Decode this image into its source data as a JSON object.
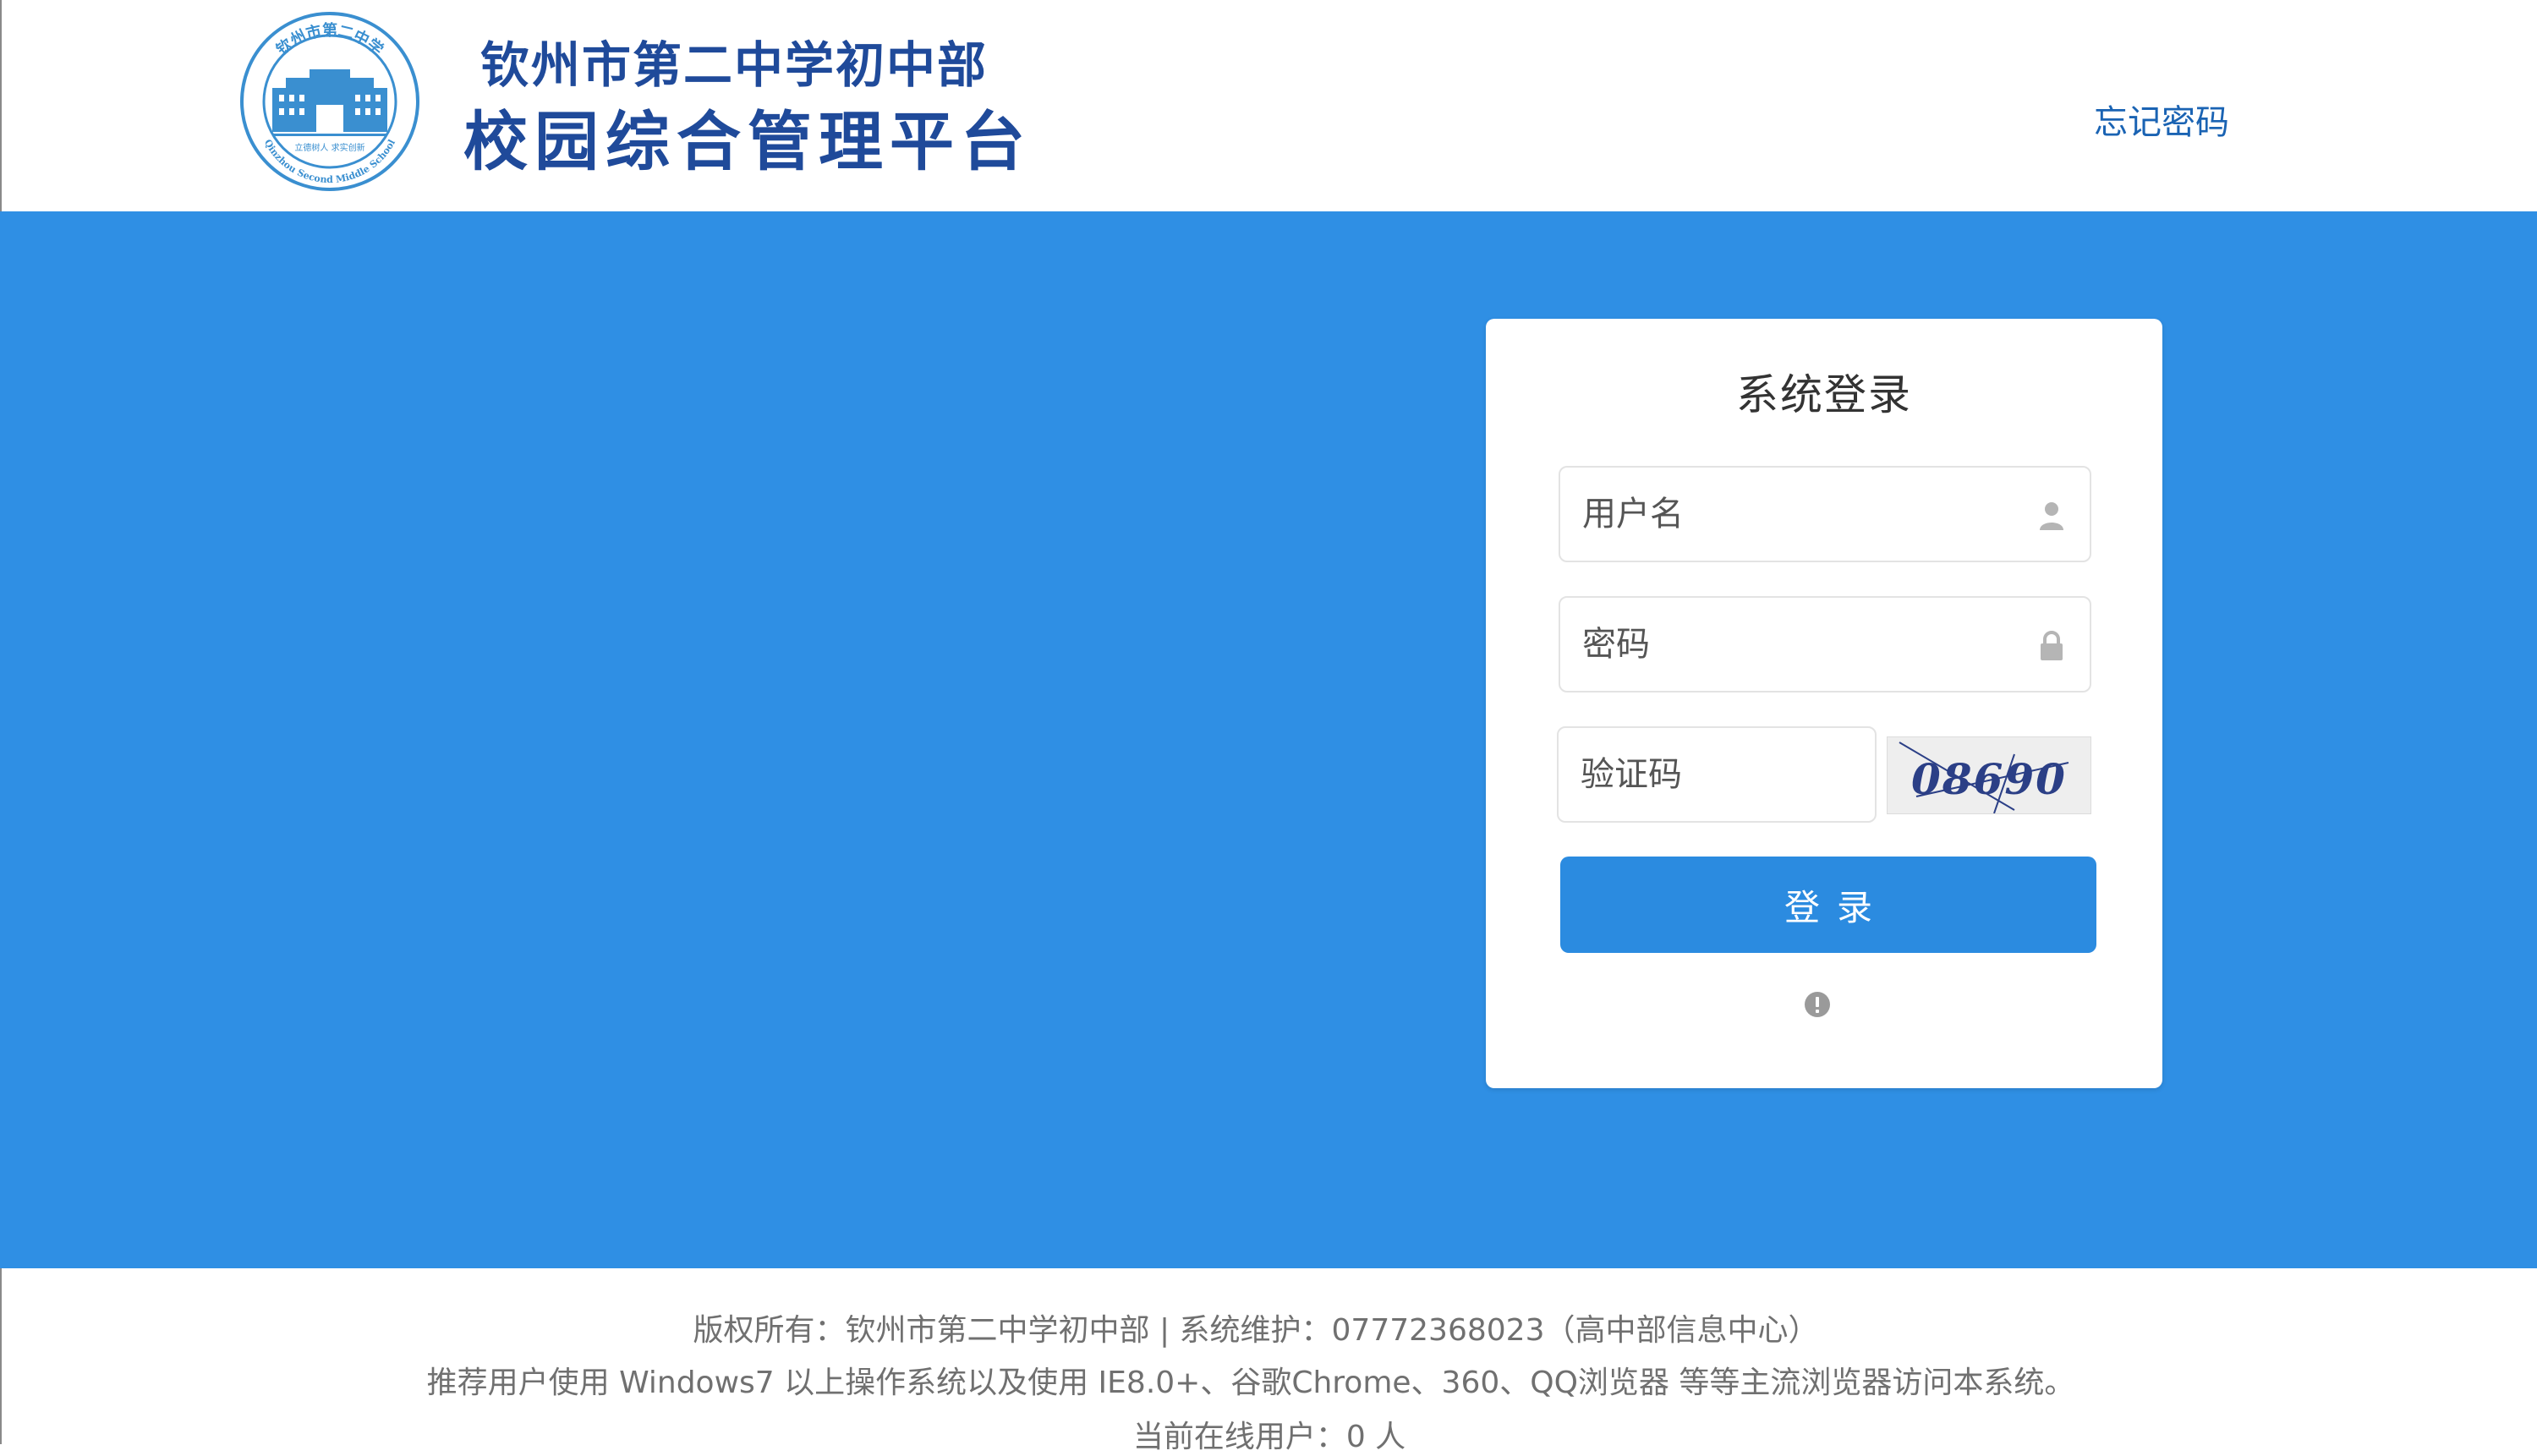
{
  "header": {
    "school_name": "钦州市第二中学初中部",
    "platform_name": "校园综合管理平台",
    "forgot_password": "忘记密码",
    "logo": {
      "ring_text_cn": "钦州市第二中学",
      "ring_text_en": "Qinzhou Second Middle School",
      "motto": "立德树人 求实创新"
    }
  },
  "login": {
    "title": "系统登录",
    "username_placeholder": "用户名",
    "password_placeholder": "密码",
    "captcha_placeholder": "验证码",
    "captcha_code": "08690",
    "submit_label": "登录",
    "icons": {
      "username": "user-icon",
      "password": "lock-icon",
      "notice": "info-icon"
    }
  },
  "footer": {
    "line1": "版权所有：钦州市第二中学初中部 | 系统维护：07772368023（高中部信息中心）",
    "line2": "推荐用户使用 Windows7 以上操作系统以及使用 IE8.0+、谷歌Chrome、360、QQ浏览器 等等主流浏览器访问本系统。",
    "line3": "当前在线用户：0 人"
  },
  "colors": {
    "brand_blue": "#2f8fe4",
    "title_blue": "#1f4a9a",
    "link_blue": "#1a63b3",
    "button_blue": "#2b8be0"
  }
}
